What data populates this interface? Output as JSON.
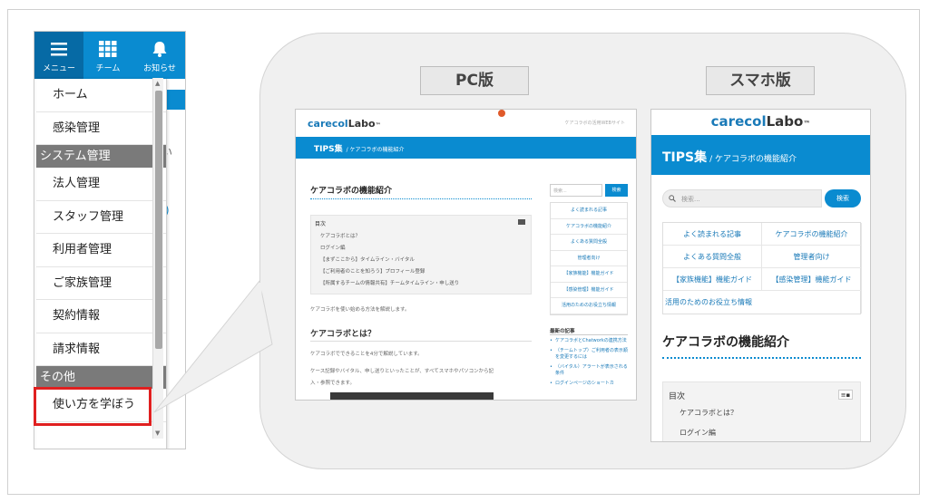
{
  "phone": {
    "header": {
      "menu_label": "メニュー",
      "team_label": "チーム",
      "notice_label": "お知らせ"
    },
    "menu": {
      "home": "ホーム",
      "infection": "感染管理",
      "section_system": "システム管理",
      "corporation": "法人管理",
      "staff": "スタッフ管理",
      "users": "利用者管理",
      "family": "ご家族管理",
      "contract": "契約情報",
      "billing": "請求情報",
      "section_other": "その他",
      "learn": "使い方を学ぼう"
    },
    "peek": {
      "text1": "い",
      "text2": ".)"
    }
  },
  "tags": {
    "pc": "PC版",
    "sp": "スマホ版"
  },
  "site": {
    "logo_main": "carecol",
    "logo_accent": "Labo",
    "logo_tm": "™",
    "pc_subtitle": "ケアコラボの活用WEBサイト",
    "badge_count": "1",
    "section": "TIPS集",
    "breadcrumb": "/ ケアコラボの機能紹介",
    "article_title": "ケアコラボの機能紹介",
    "toc_label": "目次",
    "toc_items": [
      "ケアコラボとは？",
      "ログイン編",
      "【まずここから】タイムライン・バイタル",
      "【ご利用者のことを知ろう】プロフィール登録",
      "【所属するチームの情報共有】チームタイムライン・申し送り"
    ],
    "intro": "ケアコラボを使い始める方法を解説します。",
    "h2": "ケアコラボとは？",
    "p1": "ケアコラボでできることを4分で解説しています。",
    "p2": "ケース記録やバイタル、申し送りといったことが、すべてスマホやパソコンから記",
    "p3": "入・参照できます。",
    "search_placeholder": "検索...",
    "search_button": "検索",
    "links": [
      "よく読まれる記事",
      "ケアコラボの機能紹介",
      "よくある質問全般",
      "管理者向け",
      "【家族機能】機能ガイド",
      "【感染管理】機能ガイド",
      "活用のためのお役立ち情報"
    ],
    "recent_heading": "最新の記事",
    "recent": [
      "ケアコラボとChatworkの連携方法",
      "（チームトップ）ご利用者の表示順を変更するには",
      "（バイタル）アラートが表示される条件",
      "ログインページのショートカ"
    ],
    "toc_icon": "≡▪"
  }
}
